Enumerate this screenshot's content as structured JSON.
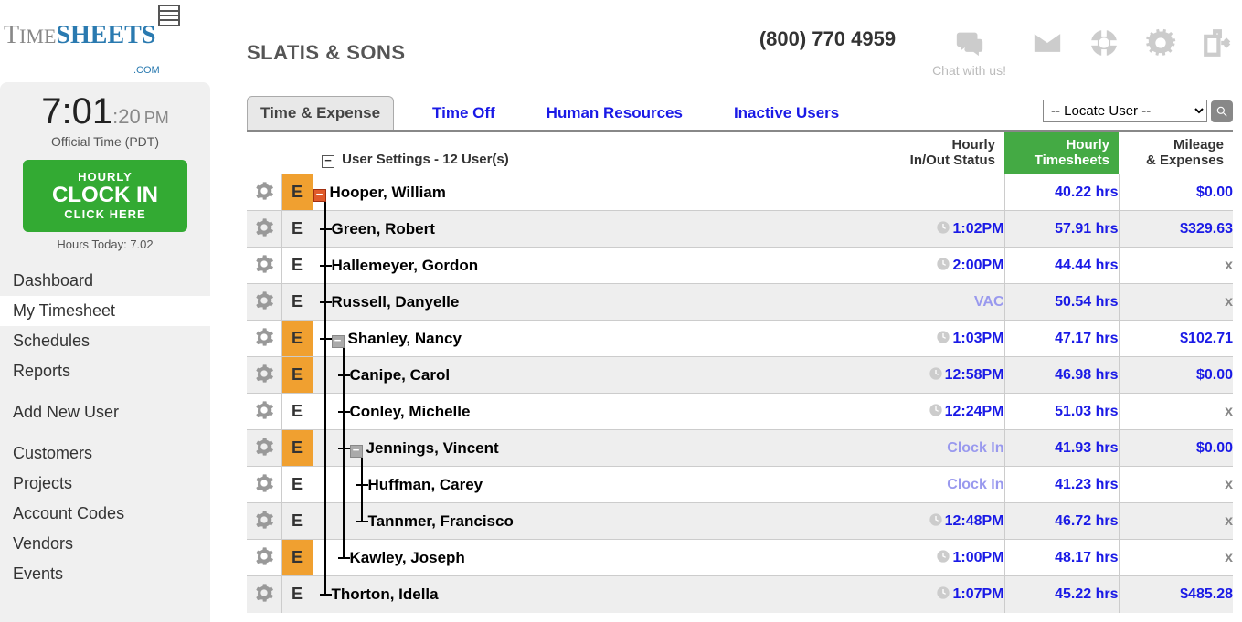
{
  "logo": {
    "text1": "T",
    "text2": "IME",
    "text3": "SHEETS",
    "dotcom": ".COM"
  },
  "company": "SLATIS & SONS",
  "phone": "(800) 770 4959",
  "chat_label": "Chat with us!",
  "clock": {
    "hm": "7:01",
    "s": ":20",
    "ampm": "PM",
    "official": "Official Time (PDT)"
  },
  "clockin": {
    "l1": "HOURLY",
    "l2": "CLOCK IN",
    "l3": "CLICK HERE"
  },
  "hours_today": "Hours Today: 7.02",
  "nav": {
    "items": [
      "Dashboard",
      "My Timesheet",
      "Schedules",
      "Reports",
      "Add New User",
      "Customers",
      "Projects",
      "Account Codes",
      "Vendors",
      "Events"
    ],
    "active_index": 1
  },
  "tabs": {
    "items": [
      "Time & Expense",
      "Time Off",
      "Human Resources",
      "Inactive Users"
    ],
    "active_index": 0
  },
  "locate": {
    "selected": "-- Locate User --"
  },
  "headers": {
    "user_settings": "User Settings - 12 User(s)",
    "status1": "Hourly",
    "status2": "In/Out Status",
    "hours1": "Hourly",
    "hours2": "Timesheets",
    "exp1": "Mileage",
    "exp2": "& Expenses"
  },
  "e_label": "E",
  "rows": [
    {
      "name": "Hooper, William",
      "indent": 0,
      "box": "orange",
      "e_orange": true,
      "status": "",
      "status_kind": "",
      "clock": false,
      "hours": "40.22 hrs",
      "exp": "$0.00",
      "exp_kind": "blue",
      "alt": false
    },
    {
      "name": "Green, Robert",
      "indent": 1,
      "box": "",
      "e_orange": false,
      "status": "1:02PM",
      "status_kind": "blue",
      "clock": true,
      "hours": "57.91 hrs",
      "exp": "$329.63",
      "exp_kind": "blue",
      "alt": true
    },
    {
      "name": "Hallemeyer, Gordon",
      "indent": 1,
      "box": "",
      "e_orange": false,
      "status": "2:00PM",
      "status_kind": "blue",
      "clock": true,
      "hours": "44.44 hrs",
      "exp": "x",
      "exp_kind": "x",
      "alt": false
    },
    {
      "name": "Russell, Danyelle",
      "indent": 1,
      "box": "",
      "e_orange": false,
      "status": "VAC",
      "status_kind": "violet",
      "clock": false,
      "hours": "50.54 hrs",
      "exp": "x",
      "exp_kind": "x",
      "alt": true
    },
    {
      "name": "Shanley, Nancy",
      "indent": 1,
      "box": "gray",
      "e_orange": true,
      "status": "1:03PM",
      "status_kind": "blue",
      "clock": true,
      "hours": "47.17 hrs",
      "exp": "$102.71",
      "exp_kind": "blue",
      "alt": false
    },
    {
      "name": "Canipe, Carol",
      "indent": 2,
      "box": "",
      "e_orange": true,
      "status": "12:58PM",
      "status_kind": "blue",
      "clock": true,
      "hours": "46.98 hrs",
      "exp": "$0.00",
      "exp_kind": "blue",
      "alt": true
    },
    {
      "name": "Conley, Michelle",
      "indent": 2,
      "box": "",
      "e_orange": false,
      "status": "12:24PM",
      "status_kind": "blue",
      "clock": true,
      "hours": "51.03 hrs",
      "exp": "x",
      "exp_kind": "x",
      "alt": false
    },
    {
      "name": "Jennings, Vincent",
      "indent": 2,
      "box": "gray",
      "e_orange": true,
      "status": "Clock In",
      "status_kind": "violet",
      "clock": false,
      "hours": "41.93 hrs",
      "exp": "$0.00",
      "exp_kind": "blue",
      "alt": true
    },
    {
      "name": "Huffman, Carey",
      "indent": 3,
      "box": "",
      "e_orange": false,
      "status": "Clock In",
      "status_kind": "violet",
      "clock": false,
      "hours": "41.23 hrs",
      "exp": "x",
      "exp_kind": "x",
      "alt": false
    },
    {
      "name": "Tannmer, Francisco",
      "indent": 3,
      "box": "",
      "e_orange": false,
      "status": "12:48PM",
      "status_kind": "blue",
      "clock": true,
      "hours": "46.72 hrs",
      "exp": "x",
      "exp_kind": "x",
      "alt": true
    },
    {
      "name": "Kawley, Joseph",
      "indent": 2,
      "box": "",
      "e_orange": true,
      "status": "1:00PM",
      "status_kind": "blue",
      "clock": true,
      "hours": "48.17 hrs",
      "exp": "x",
      "exp_kind": "x",
      "alt": false
    },
    {
      "name": "Thorton, Idella",
      "indent": 1,
      "box": "",
      "e_orange": false,
      "status": "1:07PM",
      "status_kind": "blue",
      "clock": true,
      "hours": "45.22 hrs",
      "exp": "$485.28",
      "exp_kind": "blue",
      "alt": true
    }
  ]
}
